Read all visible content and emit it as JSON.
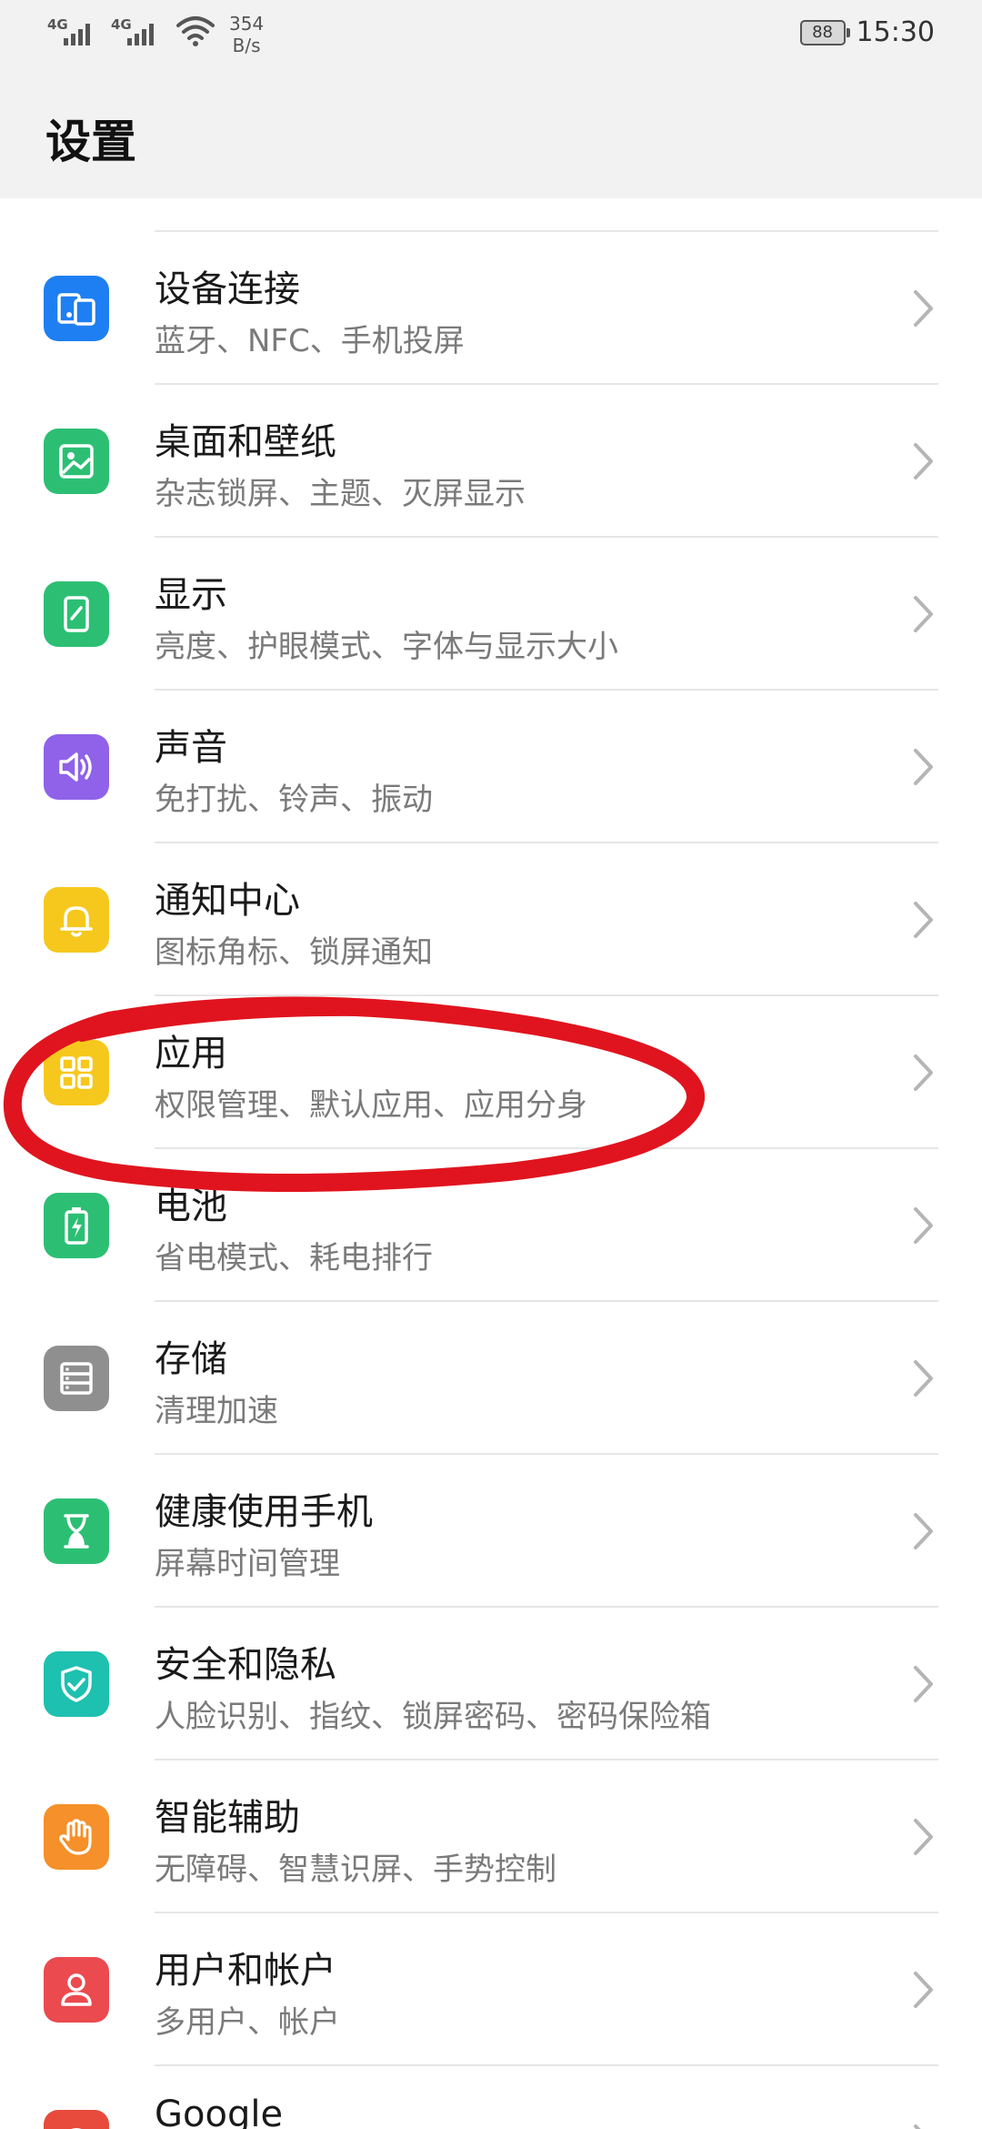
{
  "status_bar": {
    "sim1": "4G",
    "sim2": "4G",
    "speed_value": "354",
    "speed_unit": "B/s",
    "battery": "88",
    "time": "15:30"
  },
  "header": {
    "title": "设置"
  },
  "items": [
    {
      "title": "",
      "subtitle": "",
      "color": "#ffffff",
      "icon": "partial-row"
    },
    {
      "title": "设备连接",
      "subtitle": "蓝牙、NFC、手机投屏",
      "color": "#1e7ff2",
      "icon": "devices-icon"
    },
    {
      "title": "桌面和壁纸",
      "subtitle": "杂志锁屏、主题、灭屏显示",
      "color": "#2cbf74",
      "icon": "image-icon"
    },
    {
      "title": "显示",
      "subtitle": "亮度、护眼模式、字体与显示大小",
      "color": "#2cbf74",
      "icon": "display-icon"
    },
    {
      "title": "声音",
      "subtitle": "免打扰、铃声、振动",
      "color": "#8f62e9",
      "icon": "speaker-icon"
    },
    {
      "title": "通知中心",
      "subtitle": "图标角标、锁屏通知",
      "color": "#f6c81d",
      "icon": "bell-icon"
    },
    {
      "title": "应用",
      "subtitle": "权限管理、默认应用、应用分身",
      "color": "#f6c81d",
      "icon": "apps-grid-icon"
    },
    {
      "title": "电池",
      "subtitle": "省电模式、耗电排行",
      "color": "#2cbf74",
      "icon": "battery-icon"
    },
    {
      "title": "存储",
      "subtitle": "清理加速",
      "color": "#8f8f8f",
      "icon": "storage-icon"
    },
    {
      "title": "健康使用手机",
      "subtitle": "屏幕时间管理",
      "color": "#2cbf74",
      "icon": "hourglass-icon"
    },
    {
      "title": "安全和隐私",
      "subtitle": "人脸识别、指纹、锁屏密码、密码保险箱",
      "color": "#1ec0b0",
      "icon": "shield-icon"
    },
    {
      "title": "智能辅助",
      "subtitle": "无障碍、智慧识屏、手势控制",
      "color": "#f5902a",
      "icon": "hand-icon"
    },
    {
      "title": "用户和帐户",
      "subtitle": "多用户、帐户",
      "color": "#eb4a4f",
      "icon": "user-icon"
    },
    {
      "title": "Google",
      "subtitle": "",
      "color": "#e84b3c",
      "icon": "google-icon"
    }
  ]
}
